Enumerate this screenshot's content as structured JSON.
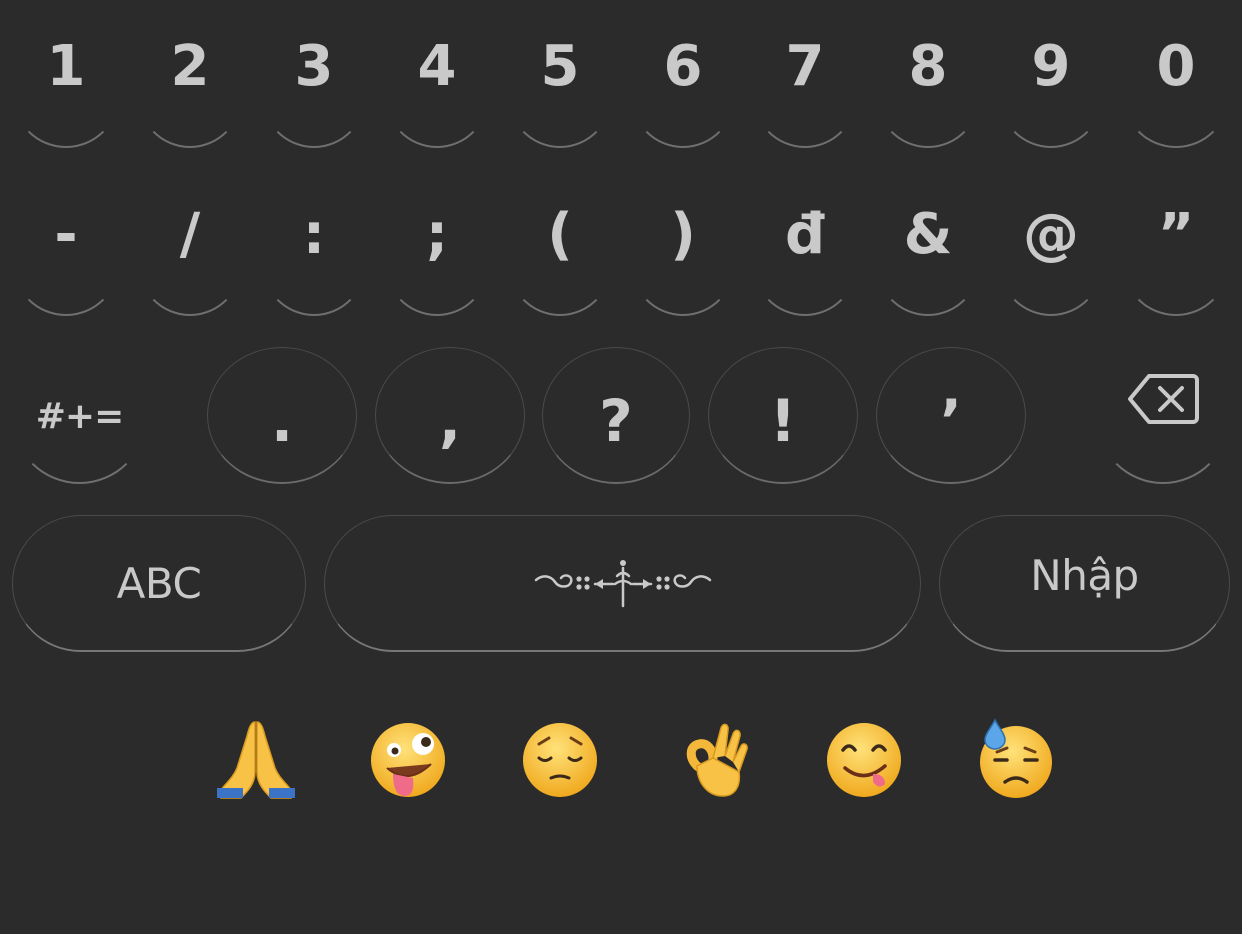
{
  "row_numbers": [
    "1",
    "2",
    "3",
    "4",
    "5",
    "6",
    "7",
    "8",
    "9",
    "0"
  ],
  "row_symbols": [
    "-",
    "/",
    ":",
    ";",
    "(",
    ")",
    "đ",
    "&",
    "@",
    "”"
  ],
  "row_punct": {
    "more_symbols_label": "#+=",
    "keys": [
      ".",
      ",",
      "?",
      "!",
      "’"
    ],
    "backspace_icon": "backspace-icon"
  },
  "bottom_row": {
    "abc_label": "ABC",
    "space_icon": "ornament-icon",
    "enter_label": "Nhập"
  },
  "emoji_suggestions": [
    {
      "name": "folded-hands-emoji",
      "char": "🙏"
    },
    {
      "name": "zany-face-emoji",
      "char": "🤪"
    },
    {
      "name": "pensive-face-emoji",
      "char": "😔"
    },
    {
      "name": "ok-hand-emoji",
      "char": "👌"
    },
    {
      "name": "yum-face-emoji",
      "char": "😋"
    },
    {
      "name": "downcast-sweat-emoji",
      "char": "😓"
    }
  ],
  "colors": {
    "background": "#2b2b2b",
    "key_text": "#c9c9c9",
    "key_outline": "#6f6f6f"
  }
}
